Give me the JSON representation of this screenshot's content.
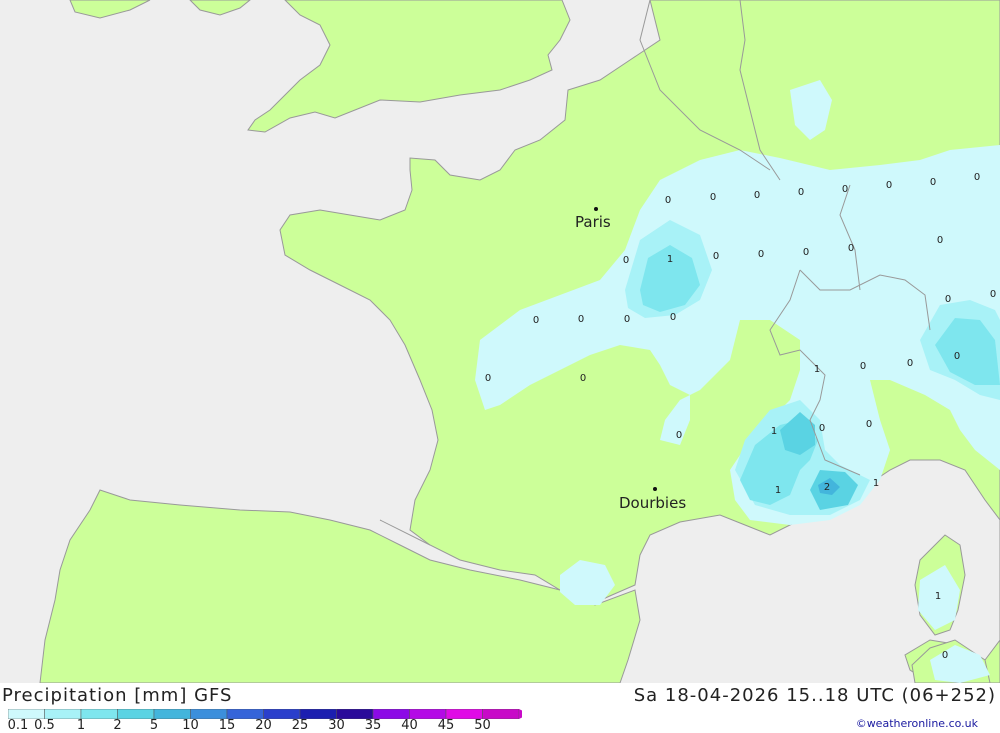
{
  "title": "Precipitation [mm] GFS",
  "datetime": "Sa 18-04-2026 15..18 UTC (06+252)",
  "credit": "©weatheronline.co.uk",
  "colors": {
    "sea": "#eeeeee",
    "land": "#ccff99",
    "border": "#999999"
  },
  "legend": {
    "labels": [
      "0.1",
      "0.5",
      "1",
      "2",
      "5",
      "10",
      "15",
      "20",
      "25",
      "30",
      "35",
      "40",
      "45",
      "50"
    ],
    "colors": [
      "#cff9fc",
      "#a8f2f7",
      "#7ee6ee",
      "#5ad3e3",
      "#43b5dc",
      "#3c8fdc",
      "#3564d9",
      "#2a3fcc",
      "#1c1fb0",
      "#2a0a9a",
      "#8c0ae6",
      "#b40ae6",
      "#e00ae6",
      "#c80ac8"
    ]
  },
  "cities": [
    {
      "name": "Paris"
    },
    {
      "name": "Dourbies"
    }
  ],
  "values": [
    "0",
    "0",
    "0",
    "0",
    "0",
    "0",
    "0",
    "0",
    "0",
    "1",
    "0",
    "0",
    "0",
    "0",
    "0",
    "0",
    "0",
    "0",
    "0",
    "1",
    "0",
    "0",
    "0",
    "0",
    "0",
    "0",
    "1",
    "0",
    "0",
    "1",
    "0",
    "0",
    "1",
    "2",
    "1",
    "1",
    "0"
  ]
}
